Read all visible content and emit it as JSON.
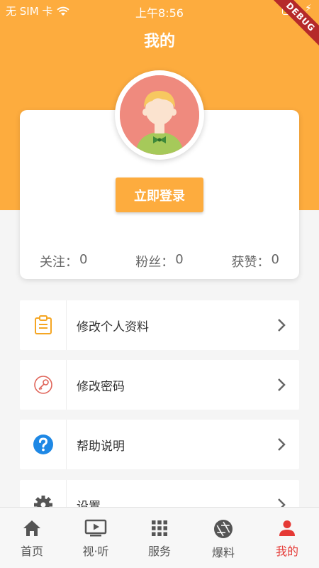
{
  "status_bar": {
    "carrier": "无 SIM 卡",
    "time": "上午8:56",
    "debug_label": "DEBUG",
    "battery_level": 0.35
  },
  "header": {
    "title": "我的"
  },
  "profile": {
    "login_label": "立即登录",
    "stats": [
      {
        "label": "关注：",
        "value": "0"
      },
      {
        "label": "粉丝：",
        "value": "0"
      },
      {
        "label": "获赞：",
        "value": "0"
      }
    ]
  },
  "menu": [
    {
      "label": "修改个人资料",
      "icon": "clipboard-icon"
    },
    {
      "label": "修改密码",
      "icon": "key-icon"
    },
    {
      "label": "帮助说明",
      "icon": "help-icon"
    },
    {
      "label": "设置",
      "icon": "gear-icon"
    }
  ],
  "bottom_nav": [
    {
      "label": "首页",
      "icon": "home-icon"
    },
    {
      "label": "视·听",
      "icon": "tv-play-icon"
    },
    {
      "label": "服务",
      "icon": "grid-icon"
    },
    {
      "label": "爆料",
      "icon": "aperture-icon"
    },
    {
      "label": "我的",
      "icon": "person-icon",
      "active": true
    }
  ],
  "colors": {
    "accent": "#fdac3e",
    "active_tab": "#e53935",
    "help_blue": "#1e88e5",
    "key_red": "#e0655a"
  }
}
